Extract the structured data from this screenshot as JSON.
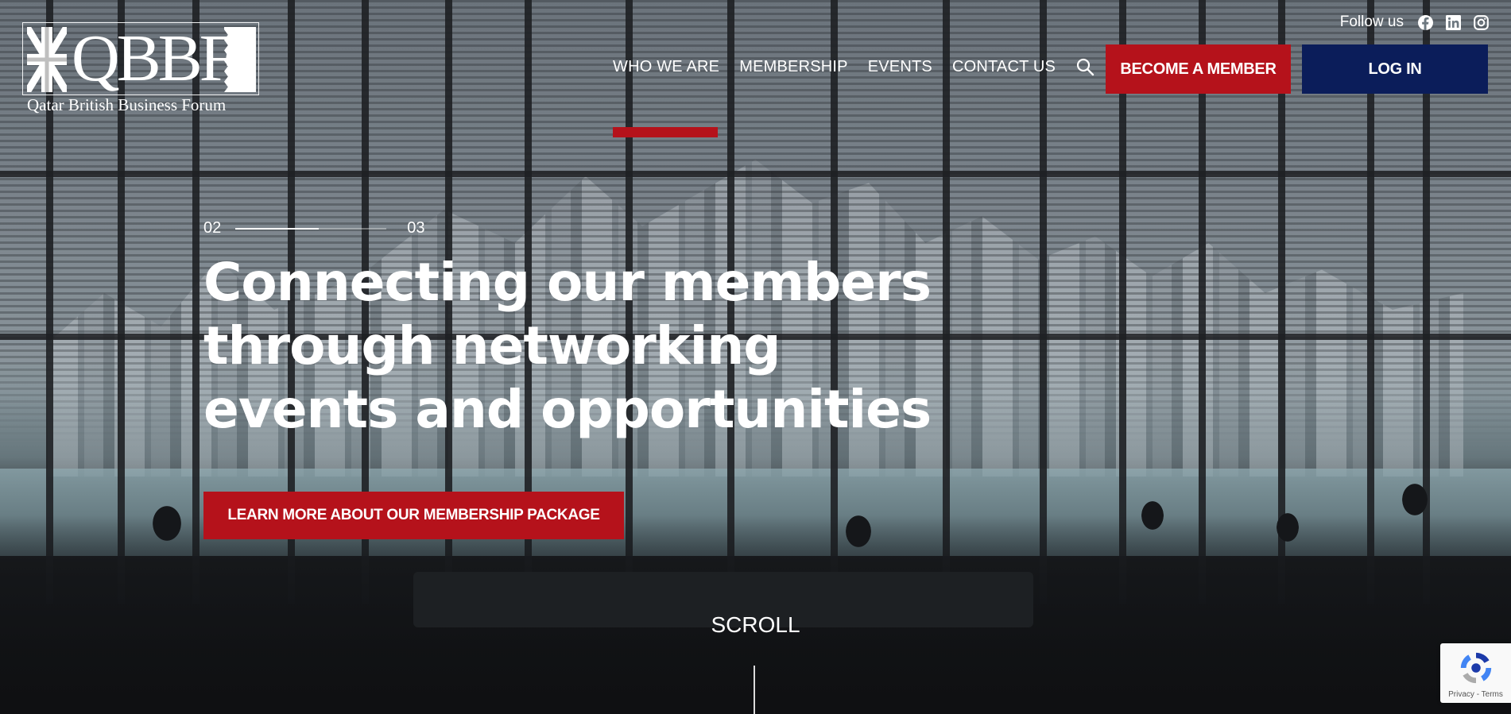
{
  "logo": {
    "wordmark": "QBBF",
    "tagline": "Qatar British Business Forum"
  },
  "social": {
    "label": "Follow us",
    "icons": [
      "facebook-icon",
      "linkedin-icon",
      "instagram-icon"
    ]
  },
  "nav": {
    "items": [
      {
        "label": "WHO WE ARE",
        "active": true
      },
      {
        "label": "MEMBERSHIP",
        "active": false
      },
      {
        "label": "EVENTS",
        "active": false
      },
      {
        "label": "CONTACT US",
        "active": false
      }
    ],
    "search_icon": "search-icon"
  },
  "buttons": {
    "become_member": "BECOME A MEMBER",
    "log_in": "LOG IN"
  },
  "slider": {
    "current": "02",
    "total": "03",
    "progress": 0.55
  },
  "hero": {
    "headline": "Connecting our members through networking events and opportunities",
    "cta": "LEARN MORE ABOUT OUR MEMBERSHIP PACKAGE",
    "scroll": "SCROLL"
  },
  "recaptcha": {
    "links": "Privacy - Terms"
  },
  "colors": {
    "brand_red": "#b5121b",
    "brand_navy": "#0b1d5a",
    "text": "#ffffff"
  }
}
